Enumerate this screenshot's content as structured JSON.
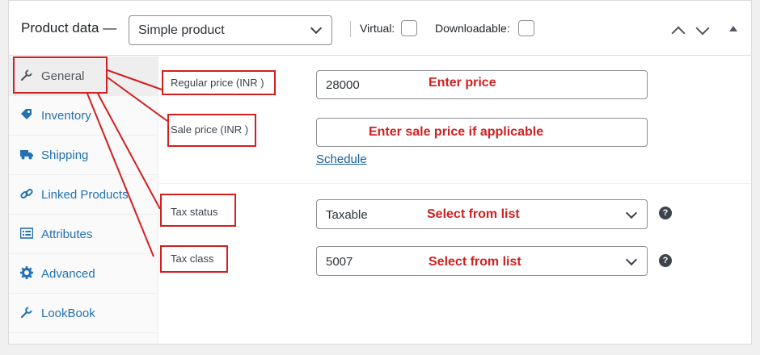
{
  "header": {
    "title": "Product data —",
    "product_type": "Simple product",
    "virtual_label": "Virtual:",
    "downloadable_label": "Downloadable:"
  },
  "sidebar": {
    "items": [
      {
        "label": "General",
        "icon": "wrench-icon"
      },
      {
        "label": "Inventory",
        "icon": "tag-icon"
      },
      {
        "label": "Shipping",
        "icon": "truck-icon"
      },
      {
        "label": "Linked Products",
        "icon": "link-icon"
      },
      {
        "label": "Attributes",
        "icon": "list-icon"
      },
      {
        "label": "Advanced",
        "icon": "gear-icon"
      },
      {
        "label": "LookBook",
        "icon": "wrench-icon"
      }
    ],
    "active": "General"
  },
  "fields": {
    "regular_price": {
      "label": "Regular price (INR )",
      "value": "28000",
      "hint": "Enter price"
    },
    "sale_price": {
      "label": "Sale price (INR )",
      "value": "",
      "hint": "Enter sale price if applicable"
    },
    "schedule_link": "Schedule",
    "tax_status": {
      "label": "Tax status",
      "value": "Taxable",
      "hint": "Select from list"
    },
    "tax_class": {
      "label": "Tax class",
      "value": "5007",
      "hint": "Select from list"
    }
  },
  "colors": {
    "accent": "#2271b1",
    "annotation": "#d21f1f",
    "border": "#8c8f94"
  }
}
